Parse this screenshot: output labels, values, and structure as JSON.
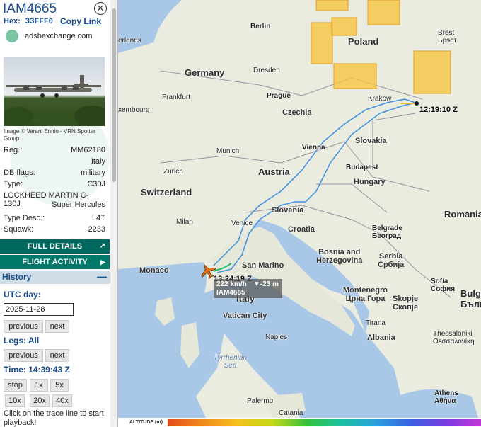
{
  "aircraft": {
    "callsign": "IAM4665",
    "hex_label": "Hex:",
    "hex": "33FFF0",
    "copy_link": "Copy Link",
    "source": "adsbexchange.com",
    "photo_credit": "Image © Varani Ennio - VRN Spotter Group",
    "details": [
      {
        "key": "Reg.:",
        "value": "MM62180"
      },
      {
        "key": "",
        "value": "Italy"
      },
      {
        "key": "DB flags:",
        "value": "military"
      },
      {
        "key": "Type:",
        "value": "C30J"
      },
      {
        "key": "LOCKHEED MARTIN C-130J",
        "value": ""
      },
      {
        "key": "",
        "value": "Super Hercules"
      },
      {
        "key": "Type Desc.:",
        "value": "L4T"
      },
      {
        "key": "Squawk:",
        "value": "2233"
      }
    ]
  },
  "buttons": {
    "full_details": "FULL DETAILS",
    "flight_activity": "FLIGHT ACTIVITY"
  },
  "history": {
    "title": "History",
    "collapse": "—",
    "utc_day_label": "UTC day:",
    "utc_day_value": "2025-11-28",
    "previous": "previous",
    "next": "next",
    "legs_label": "Legs: All",
    "time_label": "Time: 14:39:43 Z",
    "speed_buttons": [
      "stop",
      "1x",
      "5x",
      "10x",
      "20x",
      "40x"
    ],
    "footer": "Click on the trace line to start playback!"
  },
  "map": {
    "countries": [
      {
        "name": "Germany"
      },
      {
        "name": "Poland"
      },
      {
        "name": "Czechia"
      },
      {
        "name": "Austria"
      },
      {
        "name": "Slovakia"
      },
      {
        "name": "Hungary"
      },
      {
        "name": "Switzerland"
      },
      {
        "name": "Slovenia"
      },
      {
        "name": "Croatia"
      },
      {
        "name": "Romania"
      },
      {
        "name": "Italy"
      },
      {
        "name": "Serbia\nСрбија"
      },
      {
        "name": "Bosnia and\nHerzegovina"
      },
      {
        "name": "Monaco"
      },
      {
        "name": "San Marino"
      },
      {
        "name": "Montenegro\nЦрна Гора"
      },
      {
        "name": "Skopje\nСкопје"
      },
      {
        "name": "Albania"
      },
      {
        "name": "Bulg\nБълг"
      },
      {
        "name": "Vatican City"
      },
      {
        "name": "Tyrrhenian\nSea"
      }
    ],
    "cities": [
      "Berlin",
      "Dresden",
      "Prague",
      "Krakow",
      "Brest\nБрэст",
      "Frankfurt",
      "Munich",
      "Vienna",
      "Budapest",
      "Zurich",
      "Milan",
      "Venice",
      "Belgrade\nБеоград",
      "Sofia\nСофия",
      "Tirana",
      "Naples",
      "Thessaloniki\nΘεσσαλονίκη",
      "Athens\nΑθήνα",
      "Palermo",
      "Catania",
      "xembourg",
      "erlands"
    ],
    "start_time_label": "12:19:10 Z",
    "end_time_label": "13:24:19 Z",
    "info_speed": "222 km/h",
    "info_alt": "▼-23 m",
    "info_callsign": "IAM4665",
    "altitude_label": "ALTITUDE (m)"
  },
  "colors": {
    "accent": "#1a4d8c",
    "button_bg": "#00695f",
    "track_color": "#3d8fe0",
    "plane_color": "#e8731a",
    "weather_box": "#f5c542"
  }
}
